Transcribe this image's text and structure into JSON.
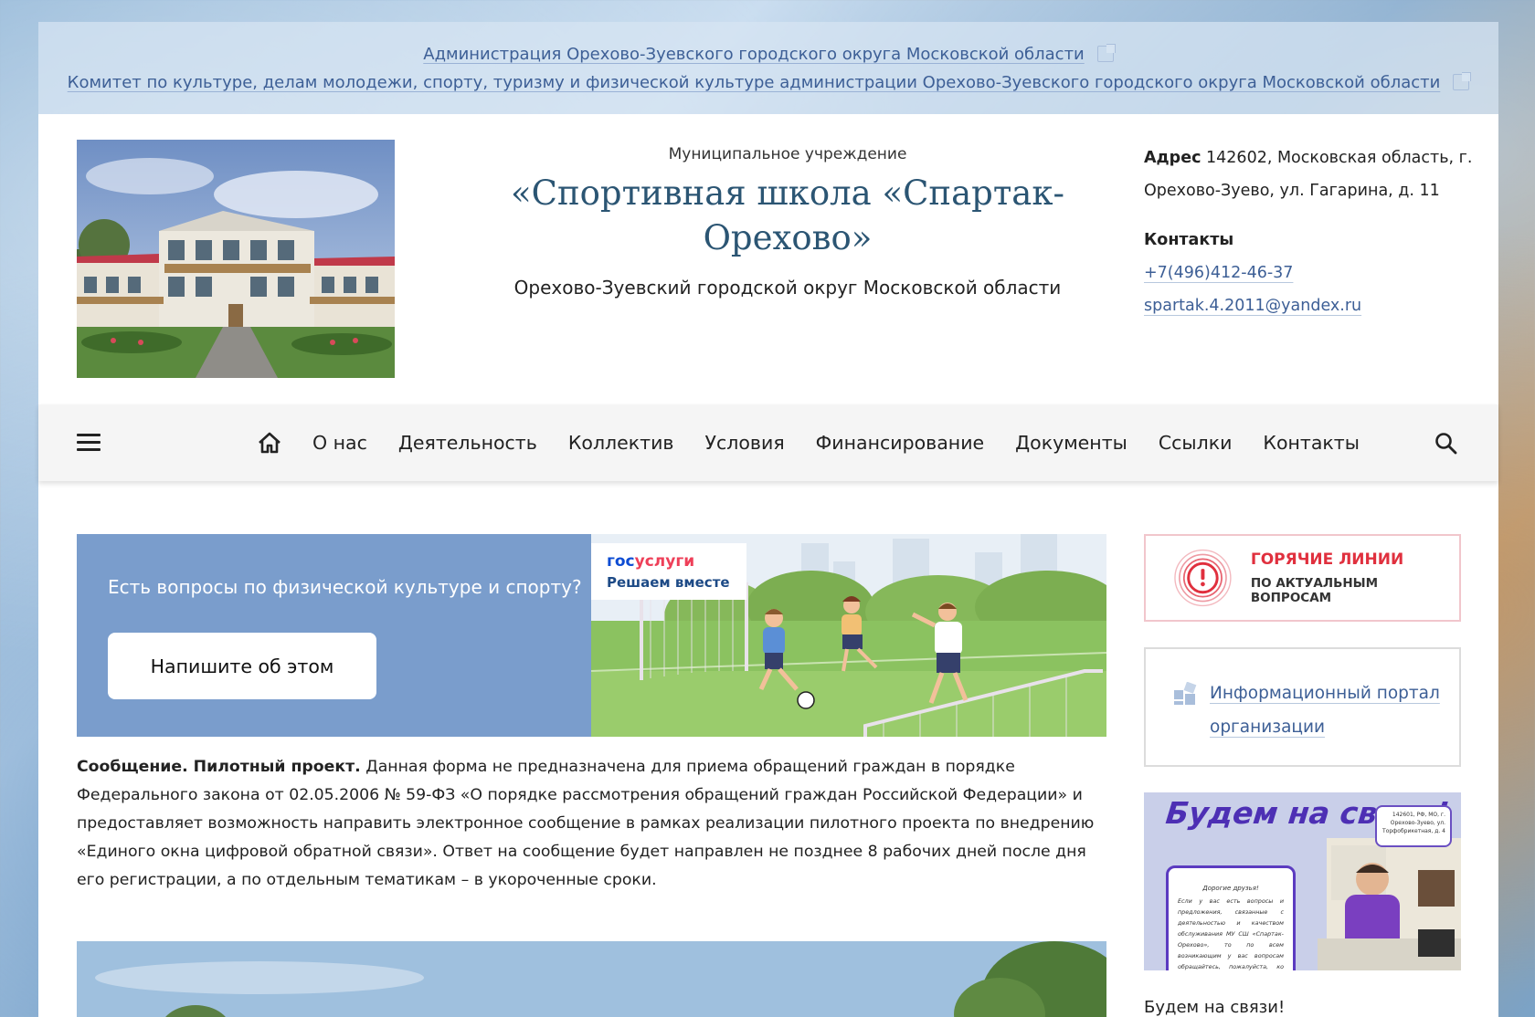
{
  "top_links": [
    {
      "label": "Администрация Орехово-Зуевского городского округа Московской области"
    },
    {
      "label": "Комитет по культуре, делам молодежи, спорту, туризму и физической культуре администрации Орехово-Зуевского городского округа Московской области"
    }
  ],
  "header": {
    "subtitle": "Муниципальное учреждение",
    "title": "«Спортивная школа «Спартак-Орехово»",
    "region": "Орехово-Зуевский городской округ Московской области",
    "address_label": "Адрес",
    "address": "142602, Московская область, г. Орехово-Зуево, ул. Гагарина, д. 11",
    "contacts_label": "Контакты",
    "phone": "+7(496)412-46-37",
    "email": "spartak.4.2011@yandex.ru"
  },
  "nav": {
    "items": [
      "О нас",
      "Деятельность",
      "Коллектив",
      "Условия",
      "Финансирование",
      "Документы",
      "Ссылки",
      "Контакты"
    ]
  },
  "banner": {
    "question": "Есть вопросы по физической культуре и спорту?",
    "button": "Напишите об этом",
    "gos_logo_a": "гос",
    "gos_logo_b": "услуги",
    "gos_sub": "Решаем вместе"
  },
  "message": {
    "bold": "Сообщение. Пилотный проект.",
    "text": " Данная форма не предназначена для приема обращений граждан в порядке Федерального закона от 02.05.2006 № 59-ФЗ «О порядке рассмотрения обращений граждан Российской Федерации» и предоставляет возможность направить электронное сообщение в рамках реализации пилотного проекта по внедрению «Единого окна цифровой обратной связи». Ответ на сообщение будет направлен не позднее 8 рабочих дней после дня его регистрации, а по отдельным тематикам – в укороченные сроки."
  },
  "sidebar": {
    "hot_title": "ГОРЯЧИЕ ЛИНИИ",
    "hot_sub": "ПО АКТУАЛЬНЫМ ВОПРОСАМ",
    "portal": "Информационный портал организации",
    "bnews_title": "Будем на связи!",
    "bnews_addr": "142601, РФ, МО, г. Орехово-Зуево, ул. Торфобрикетная, д. 4",
    "bnews_greet": "Дорогие друзья!",
    "bnews_text": "Если у вас есть вопросы и предложения, связанные с деятельностью и качеством обслуживания МУ СШ «Спартак-Орехово», то по всем возникающим у вас вопросам обращайтесь, пожалуйста, ко мне в удобный для вас время.",
    "caption": "Будем на связи!"
  },
  "colors": {
    "link": "#3d5f96",
    "title": "#2b5573",
    "banner_bg": "#7a9dcc",
    "hot_red": "#e0303e"
  }
}
